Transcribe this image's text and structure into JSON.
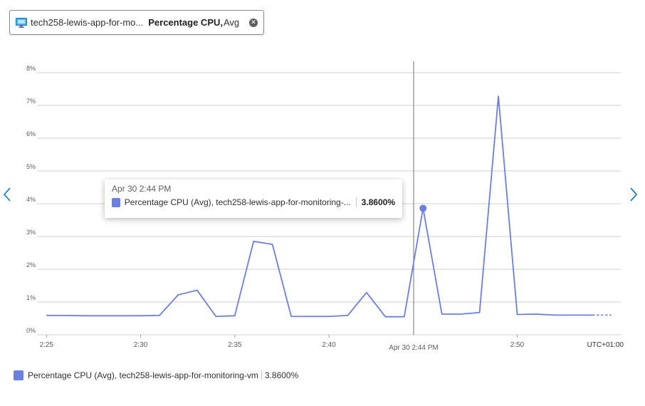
{
  "metric_pill": {
    "resource": "tech258-lewis-app-for-mo...",
    "metric": "Percentage CPU,",
    "aggregation": "Avg",
    "icon": "vm-icon"
  },
  "colors": {
    "series": "#6b7ee3",
    "grid": "#d2d0ce",
    "crosshair": "#8a8886"
  },
  "chart_data": {
    "type": "line",
    "y_ticks": [
      "0%",
      "1%",
      "2%",
      "3%",
      "4%",
      "5%",
      "6%",
      "7%",
      "8%"
    ],
    "ylim": [
      0,
      8
    ],
    "x_ticks": [
      {
        "t": 145,
        "label": "2:25"
      },
      {
        "t": 150,
        "label": "2:30"
      },
      {
        "t": 155,
        "label": "2:35"
      },
      {
        "t": 160,
        "label": "2:40"
      },
      {
        "t": 170,
        "label": "2:50"
      }
    ],
    "xlim": [
      144.5,
      175.5
    ],
    "timezone": "UTC+01:00",
    "crosshair_label": "Apr 30 2:44 PM",
    "crosshair_t": 164.5,
    "series": [
      {
        "name": "Percentage CPU (Avg), tech258-lewis-app-for-monitoring-vm",
        "x": [
          145,
          146,
          147,
          148,
          149,
          150,
          151,
          152,
          153,
          154,
          155,
          156,
          157,
          158,
          159,
          160,
          161,
          162,
          163,
          164,
          165,
          166,
          167,
          168,
          169,
          170,
          171,
          172,
          173,
          174
        ],
        "values": [
          0.59,
          0.59,
          0.58,
          0.58,
          0.58,
          0.58,
          0.59,
          1.22,
          1.36,
          0.56,
          0.58,
          2.85,
          2.76,
          0.56,
          0.56,
          0.56,
          0.59,
          1.29,
          0.55,
          0.55,
          3.86,
          0.63,
          0.63,
          0.68,
          7.28,
          0.62,
          0.63,
          0.6,
          0.6,
          0.6
        ],
        "projected_until": 175
      }
    ]
  },
  "tooltip": {
    "time": "Apr 30 2:44 PM",
    "name": "Percentage CPU (Avg), tech258-lewis-app-for-monitoring-...",
    "value": "3.8600%",
    "point_index": 20
  },
  "legend": {
    "name": "Percentage CPU (Avg), tech258-lewis-app-for-monitoring-vm",
    "value": "3.8600%"
  }
}
